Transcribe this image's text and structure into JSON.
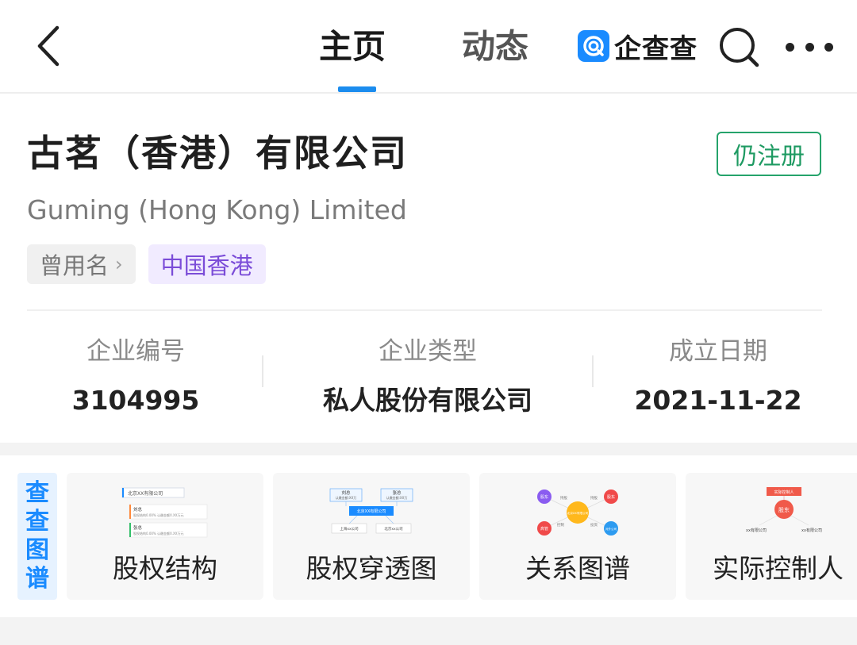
{
  "nav": {
    "tabs": [
      {
        "label": "主页",
        "active": true
      },
      {
        "label": "动态",
        "active": false
      }
    ],
    "brand_name": "企查查",
    "accent_color": "#1b8cee",
    "icons": [
      "back-chevron-icon",
      "search-icon",
      "more-icon"
    ]
  },
  "company": {
    "name": "古茗（香港）有限公司",
    "english_name": "Guming (Hong Kong) Limited",
    "status": "仍注册",
    "status_color": "#1e9a62",
    "tags": {
      "former_names": "曾用名",
      "region": "中国香港"
    }
  },
  "info": [
    {
      "label": "企业编号",
      "value": "3104995"
    },
    {
      "label": "企业类型",
      "value": "私人股份有限公司"
    },
    {
      "label": "成立日期",
      "value": "2021-11-22"
    }
  ],
  "tools": {
    "section_label": [
      "查",
      "查",
      "图",
      "谱"
    ],
    "cards": [
      {
        "title": "股权结构",
        "thumb": {
          "company": "北京XX有限公司",
          "holders": [
            {
              "name": "刘总",
              "detail": "股权结构0.00% 认缴金额X.XX万元"
            },
            {
              "name": "张总",
              "detail": "股权结构0.00% 认缴金额X.XX万元"
            }
          ]
        }
      },
      {
        "title": "股权穿透图",
        "thumb": {
          "top_left": {
            "name": "刘总",
            "detail": "认缴金额:XX万"
          },
          "top_right": {
            "name": "张总",
            "detail": "认缴金额:XX万"
          },
          "center": "北京XX有限公司",
          "bottom_left": "上海xx公司",
          "bottom_right": "北京xx公司"
        }
      },
      {
        "title": "关系图谱",
        "thumb": {
          "center": "北京XX有限公司",
          "nodes": [
            "股东",
            "股东",
            "高管",
            "对外公司"
          ],
          "edges": [
            "持股",
            "持股",
            "控制",
            "投资"
          ]
        }
      },
      {
        "title": "实际控制人",
        "thumb": {
          "top": "实际控制人",
          "center": "股东",
          "left": "xx有限公司",
          "right": "xx有限公司"
        }
      }
    ]
  }
}
